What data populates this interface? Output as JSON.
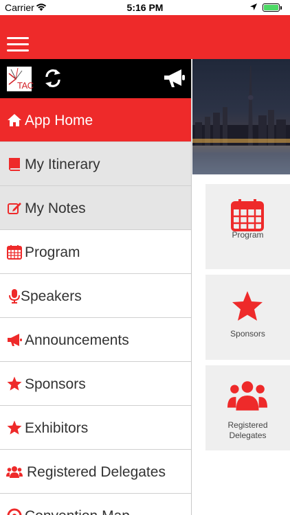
{
  "status_bar": {
    "carrier": "Carrier",
    "time": "5:16 PM"
  },
  "brand": {
    "logo_text": "TAC",
    "accent_color": "#ee2a2a"
  },
  "menu": [
    {
      "label": "App Home",
      "icon": "home-icon"
    },
    {
      "label": "My Itinerary",
      "icon": "book-icon"
    },
    {
      "label": "My Notes",
      "icon": "edit-icon"
    },
    {
      "label": "Program",
      "icon": "calendar-icon"
    },
    {
      "label": "Speakers",
      "icon": "microphone-icon"
    },
    {
      "label": "Announcements",
      "icon": "bullhorn-icon"
    },
    {
      "label": "Sponsors",
      "icon": "star-icon"
    },
    {
      "label": "Exhibitors",
      "icon": "star-icon"
    },
    {
      "label": "Registered Delegates",
      "icon": "users-icon"
    },
    {
      "label": "Convention Map",
      "icon": "map-marker-icon"
    }
  ],
  "tiles": [
    {
      "label": "Program",
      "icon": "calendar-icon"
    },
    {
      "label": "Sponsors",
      "icon": "star-icon"
    },
    {
      "label": "Registered Delegates",
      "icon": "users-icon"
    }
  ]
}
